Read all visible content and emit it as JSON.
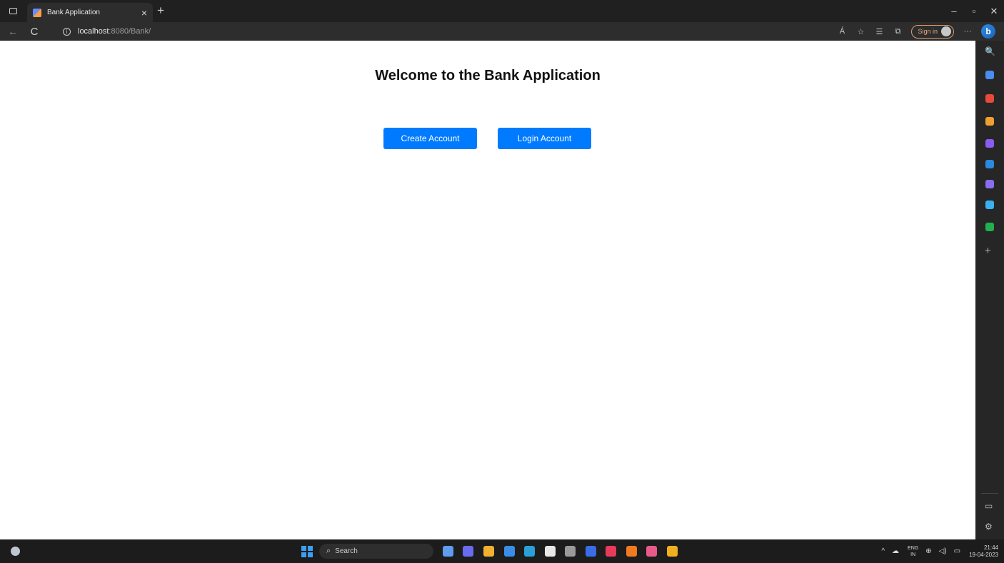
{
  "browser": {
    "tab": {
      "title": "Bank Application",
      "close": "×"
    },
    "new_tab": "+",
    "window_controls": {
      "minimize": "–",
      "restore": "▫",
      "close": "✕"
    },
    "nav": {
      "back": "←",
      "refresh": "C"
    },
    "address": {
      "host": "localhost",
      "path": ":8080/Bank/"
    },
    "toolbar": {
      "read_aloud": "Á",
      "favorite_add": "☆",
      "favorites": "☰",
      "collections": "⧉",
      "sign_in": "Sign in",
      "more": "···",
      "bing": "b"
    }
  },
  "page": {
    "heading": "Welcome to the Bank Application",
    "create_account_label": "Create Account",
    "login_account_label": "Login Account"
  },
  "sidebar": {
    "search": "🔍",
    "add": "+",
    "colors": [
      "#4a8cf0",
      "#e84a3a",
      "#f0a030",
      "#8a5cf0",
      "#2a8ae0",
      "#8a6cf0",
      "#3ab0f0",
      "#20b050"
    ]
  },
  "taskbar": {
    "search_label": "Search",
    "tray": {
      "chevron": "^",
      "lang_top": "ENG",
      "lang_bottom": "IN",
      "time": "21:44",
      "date": "19-04-2023"
    },
    "app_colors": [
      "#5f9cf0",
      "#6a6cf0",
      "#f0b030",
      "#3a8ee8",
      "#2aa0d8",
      "#e8e8e8",
      "#9a9a9a",
      "#3a6ce8",
      "#e83a5a",
      "#f07a20",
      "#e85a8a",
      "#f0b020"
    ]
  }
}
